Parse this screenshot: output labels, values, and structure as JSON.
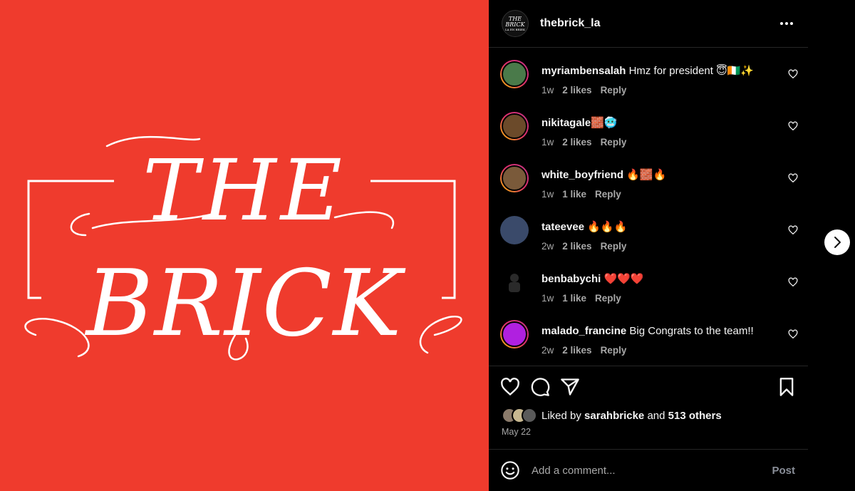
{
  "media": {
    "logo_line1": "THE",
    "logo_line2": "BRICK",
    "background": "#ef3b2d"
  },
  "post": {
    "username": "thebrick_la",
    "avatar_text_top": "THE",
    "avatar_text_mid": "BRICK",
    "avatar_text_bottom": "LA EN BRIEK",
    "more_icon": "more-horizontal-icon"
  },
  "comments": [
    {
      "username": "myriambensalah",
      "text": "Hmz for president 😇🇨🇮✨",
      "age": "1w",
      "likes": "2 likes",
      "reply": "Reply",
      "avatar_color": "#4a7a4a"
    },
    {
      "username": "nikitagale",
      "text": "🧱🥶",
      "age": "1w",
      "likes": "2 likes",
      "reply": "Reply",
      "avatar_color": "#6b4a2a"
    },
    {
      "username": "white_boyfriend",
      "text": "🔥🧱🔥",
      "age": "1w",
      "likes": "1 like",
      "reply": "Reply",
      "avatar_color": "#7a5a3a"
    },
    {
      "username": "tateevee",
      "text": "🔥🔥🔥",
      "age": "2w",
      "likes": "2 likes",
      "reply": "Reply",
      "avatar_color": "#3a4a6a"
    },
    {
      "username": "benbabychi",
      "text": "❤️❤️❤️",
      "age": "1w",
      "likes": "1 like",
      "reply": "Reply",
      "avatar_color": "#000000"
    },
    {
      "username": "malado_francine",
      "text": "Big Congrats to the team!!",
      "age": "2w",
      "likes": "2 likes",
      "reply": "Reply",
      "avatar_color": "#b020e0"
    }
  ],
  "likes": {
    "prefix": "Liked by ",
    "user": "sarahbricke",
    "and": " and ",
    "others": "513 others"
  },
  "date": "May 22",
  "add_comment": {
    "placeholder": "Add a comment...",
    "post_label": "Post"
  }
}
